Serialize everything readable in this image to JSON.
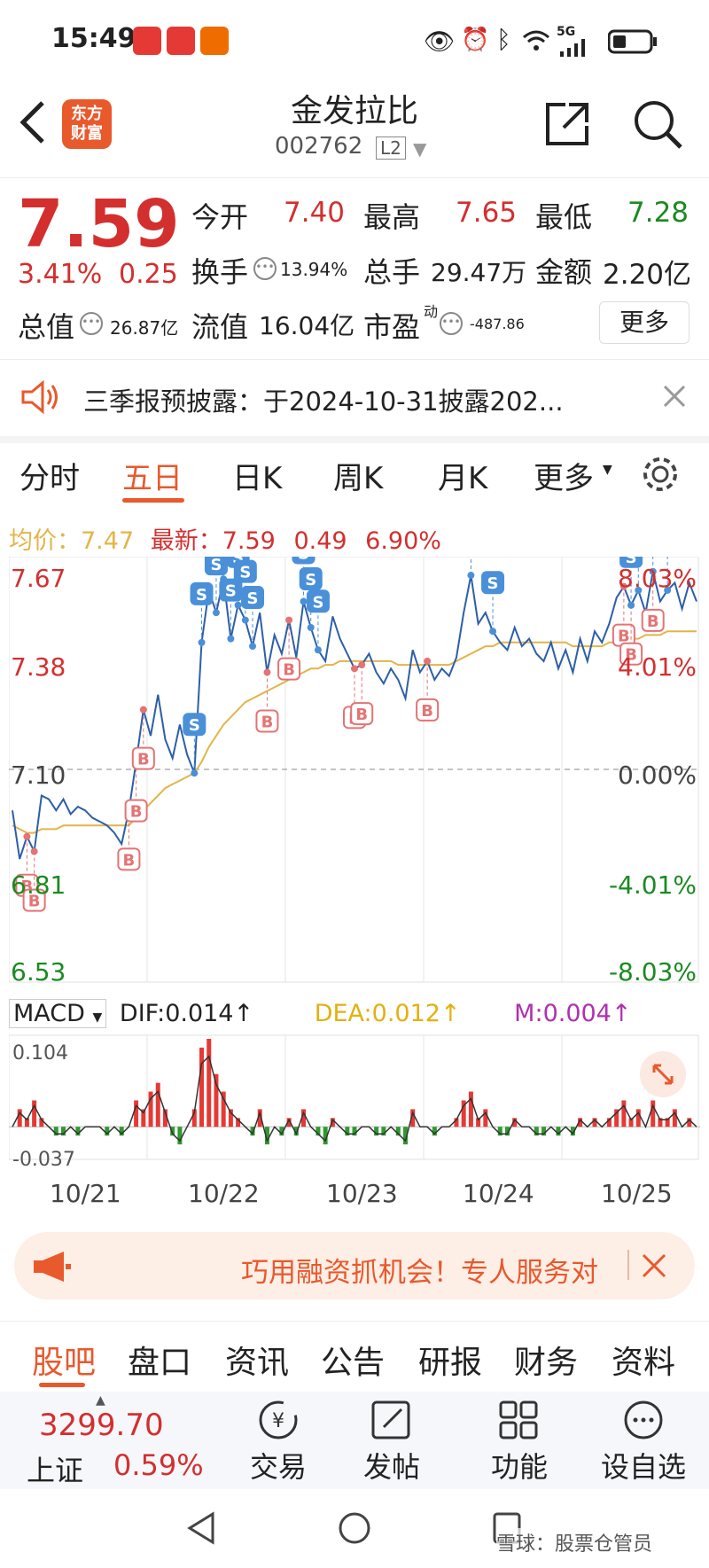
{
  "status": {
    "time": "15:49",
    "network": "5G"
  },
  "header": {
    "logo_line1": "东方",
    "logo_line2": "财富",
    "title": "金发拉比",
    "code": "002762",
    "level": "L2"
  },
  "quote": {
    "price": "7.59",
    "change_pct": "3.41%",
    "change_amt": "0.25",
    "open_label": "今开",
    "open": "7.40",
    "high_label": "最高",
    "high": "7.65",
    "low_label": "最低",
    "low": "7.28",
    "turnover_label": "换手",
    "turnover": "13.94%",
    "volume_label": "总手",
    "volume": "29.47万",
    "amount_label": "金额",
    "amount": "2.20亿",
    "total_cap_label": "总值",
    "total_cap": "26.87亿",
    "float_cap_label": "流值",
    "float_cap": "16.04亿",
    "pe_label": "市盈",
    "pe_sup": "动",
    "pe": "-487.86",
    "more_button": "更多"
  },
  "notice": {
    "text": "三季报预披露：于2024-10-31披露202..."
  },
  "chart_tabs": [
    "分时",
    "五日",
    "日K",
    "周K",
    "月K",
    "更多"
  ],
  "chart_tabs_active": 1,
  "legend": {
    "avg_label": "均价：",
    "avg": "7.47",
    "latest_label": "最新：",
    "latest": "7.59",
    "latest_change": "0.49",
    "latest_pct": "6.90%"
  },
  "macd": {
    "selector": "MACD",
    "dif": "DIF:0.014↑",
    "dea": "DEA:0.012↑",
    "m": "M:0.004↑",
    "y_top": "0.104",
    "y_bottom": "-0.037"
  },
  "chart_data": {
    "type": "line",
    "x_labels": [
      "10/21",
      "10/22",
      "10/23",
      "10/24",
      "10/25"
    ],
    "y_left_ticks": [
      "7.67",
      "7.38",
      "7.10",
      "6.81",
      "6.53"
    ],
    "y_right_ticks": [
      "8.03%",
      "4.01%",
      "0.00%",
      "-4.01%",
      "-8.03%"
    ],
    "ylim": [
      6.53,
      7.67
    ],
    "prev_close": 7.1,
    "colors": {
      "price": "#2c5fa8",
      "avg": "#e3b44a",
      "up": "#e53935",
      "down": "#2e9a2e",
      "buy": "#e57373",
      "sell": "#4a90d9"
    },
    "series": [
      {
        "name": "price",
        "values": [
          6.99,
          6.86,
          6.92,
          6.88,
          7.03,
          7.02,
          6.99,
          7.02,
          6.98,
          7.0,
          6.99,
          6.97,
          6.96,
          6.95,
          6.93,
          6.9,
          6.99,
          7.12,
          7.26,
          7.19,
          7.3,
          7.18,
          7.13,
          7.22,
          7.14,
          7.09,
          7.44,
          7.58,
          7.52,
          7.61,
          7.45,
          7.54,
          7.5,
          7.43,
          7.52,
          7.36,
          7.46,
          7.41,
          7.5,
          7.4,
          7.55,
          7.48,
          7.42,
          7.39,
          7.51,
          7.45,
          7.41,
          7.37,
          7.38,
          7.41,
          7.36,
          7.33,
          7.37,
          7.34,
          7.29,
          7.42,
          7.36,
          7.39,
          7.34,
          7.37,
          7.35,
          7.4,
          7.52,
          7.62,
          7.49,
          7.52,
          7.47,
          7.44,
          7.42,
          7.48,
          7.43,
          7.45,
          7.41,
          7.39,
          7.44,
          7.37,
          7.42,
          7.36,
          7.45,
          7.39,
          7.47,
          7.44,
          7.49,
          7.56,
          7.59,
          7.54,
          7.58,
          7.52,
          7.63,
          7.55,
          7.58,
          7.6,
          7.53,
          7.6,
          7.55
        ]
      },
      {
        "name": "avg",
        "values": [
          6.95,
          6.94,
          6.93,
          6.93,
          6.94,
          6.94,
          6.94,
          6.95,
          6.95,
          6.95,
          6.95,
          6.95,
          6.95,
          6.95,
          6.95,
          6.95,
          6.95,
          6.97,
          6.99,
          7.01,
          7.03,
          7.05,
          7.06,
          7.07,
          7.08,
          7.09,
          7.12,
          7.16,
          7.19,
          7.22,
          7.24,
          7.26,
          7.28,
          7.29,
          7.3,
          7.31,
          7.32,
          7.33,
          7.34,
          7.35,
          7.36,
          7.37,
          7.37,
          7.38,
          7.38,
          7.39,
          7.39,
          7.39,
          7.39,
          7.39,
          7.39,
          7.39,
          7.39,
          7.38,
          7.38,
          7.38,
          7.38,
          7.38,
          7.38,
          7.38,
          7.38,
          7.39,
          7.4,
          7.41,
          7.42,
          7.43,
          7.43,
          7.44,
          7.44,
          7.44,
          7.44,
          7.44,
          7.44,
          7.44,
          7.44,
          7.44,
          7.44,
          7.43,
          7.43,
          7.43,
          7.43,
          7.43,
          7.44,
          7.44,
          7.45,
          7.45,
          7.45,
          7.46,
          7.46,
          7.46,
          7.47,
          7.47,
          7.47,
          7.47,
          7.47
        ]
      }
    ],
    "buy_markers": [
      2,
      3,
      16,
      17,
      18,
      35,
      38,
      47,
      48,
      57,
      84,
      85,
      88
    ],
    "sell_markers": [
      25,
      26,
      28,
      29,
      30,
      31,
      32,
      33,
      40,
      41,
      42,
      63,
      66,
      85,
      86,
      88,
      90
    ],
    "macd_values": [
      0.0,
      0.02,
      0.01,
      0.03,
      0.01,
      0.0,
      -0.01,
      -0.01,
      0.0,
      -0.01,
      0.0,
      0.0,
      0.0,
      -0.01,
      0.0,
      -0.01,
      0.0,
      0.03,
      0.02,
      0.04,
      0.05,
      0.02,
      -0.01,
      -0.02,
      0.0,
      0.02,
      0.09,
      0.1,
      0.06,
      0.04,
      0.02,
      0.01,
      0.0,
      -0.01,
      0.02,
      -0.02,
      0.0,
      -0.01,
      0.01,
      -0.01,
      0.02,
      0.0,
      -0.01,
      -0.02,
      0.01,
      0.0,
      -0.01,
      -0.01,
      0.0,
      0.0,
      -0.01,
      -0.01,
      0.0,
      -0.01,
      -0.02,
      0.02,
      0.0,
      0.0,
      -0.01,
      0.0,
      0.0,
      0.01,
      0.03,
      0.04,
      0.01,
      0.02,
      0.0,
      -0.01,
      -0.01,
      0.01,
      0.0,
      0.0,
      -0.01,
      -0.01,
      0.0,
      -0.01,
      0.0,
      -0.01,
      0.01,
      0.0,
      0.01,
      0.0,
      0.01,
      0.02,
      0.03,
      0.01,
      0.02,
      0.0,
      0.03,
      0.01,
      0.01,
      0.02,
      0.0,
      0.01,
      0.0
    ],
    "macd_ylim": [
      -0.037,
      0.104
    ]
  },
  "banner": {
    "text": "巧用融资抓机会！专人服务对"
  },
  "bottom_tabs": [
    "股吧",
    "盘口",
    "资讯",
    "公告",
    "研报",
    "财务",
    "资料"
  ],
  "bottom_tabs_active": 0,
  "footer": {
    "index_value": "3299.70",
    "index_name": "上证",
    "index_pct": "0.59%",
    "trade": "交易",
    "post": "发帖",
    "func": "功能",
    "watch": "设自选"
  },
  "watermark": "雪球：股票仓管员"
}
